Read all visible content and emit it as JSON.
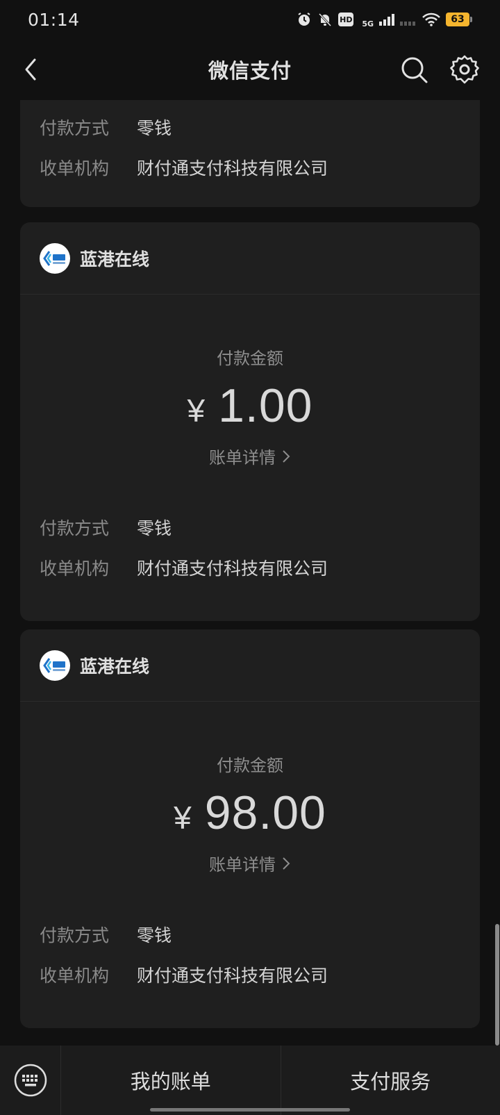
{
  "status_bar": {
    "time": "01:14",
    "network": "5G",
    "battery": "63",
    "hd_label": "HD"
  },
  "nav": {
    "title": "微信支付",
    "icons": [
      "back-arrow-icon",
      "search-icon",
      "gear-icon"
    ]
  },
  "cards": [
    {
      "info": [
        {
          "label": "付款方式",
          "value": "零钱"
        },
        {
          "label": "收单机构",
          "value": "财付通支付科技有限公司"
        }
      ]
    },
    {
      "merchant": "蓝港在线",
      "amount_label": "付款金额",
      "currency": "¥",
      "amount": "1.00",
      "detail_link": "账单详情",
      "info": [
        {
          "label": "付款方式",
          "value": "零钱"
        },
        {
          "label": "收单机构",
          "value": "财付通支付科技有限公司"
        }
      ]
    },
    {
      "merchant": "蓝港在线",
      "amount_label": "付款金额",
      "currency": "¥",
      "amount": "98.00",
      "detail_link": "账单详情",
      "info": [
        {
          "label": "付款方式",
          "value": "零钱"
        },
        {
          "label": "收单机构",
          "value": "财付通支付科技有限公司"
        }
      ]
    }
  ],
  "bottom_bar": {
    "tab_bills": "我的账单",
    "tab_services": "支付服务"
  },
  "colors": {
    "background": "#111111",
    "card": "#1f1f1f",
    "battery": "#f5b52e",
    "logo_blue": "#1f73c9"
  }
}
